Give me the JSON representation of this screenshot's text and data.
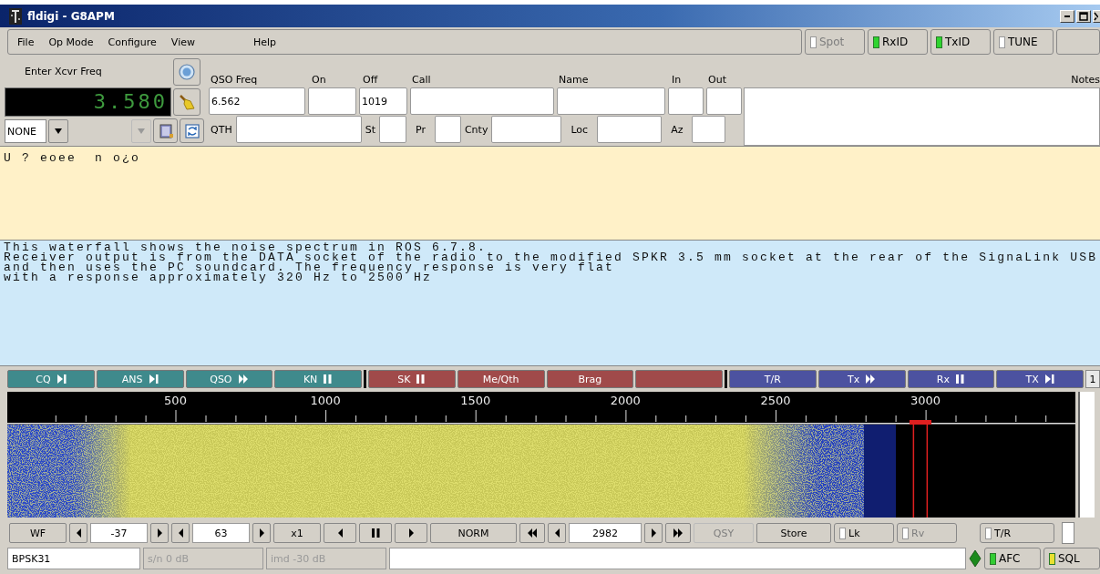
{
  "window": {
    "title": "fldigi - G8APM"
  },
  "menu": [
    {
      "label": "File"
    },
    {
      "label": "Op Mode"
    },
    {
      "label": "Configure"
    },
    {
      "label": "View"
    },
    {
      "label": "Help"
    }
  ],
  "toolbar_toggles": [
    {
      "label": "Spot",
      "on": false,
      "disabled": true
    },
    {
      "label": "RxID",
      "on": true,
      "disabled": false
    },
    {
      "label": "TxID",
      "on": true,
      "disabled": false
    },
    {
      "label": "TUNE",
      "on": false,
      "disabled": false
    }
  ],
  "xcvr": {
    "label": "Enter Xcvr Freq",
    "frequency": "3.580"
  },
  "mode_select": {
    "value": "NONE"
  },
  "log_row_1": [
    {
      "label": "QSO Freq",
      "value": "6.562"
    },
    {
      "label": "On"
    },
    {
      "label": "Off",
      "value": "1019"
    },
    {
      "label": "Call"
    },
    {
      "label": "Name"
    },
    {
      "label": "In"
    },
    {
      "label": "Out"
    }
  ],
  "notes": {
    "label": "Notes"
  },
  "log_row_2": [
    {
      "label": "QTH"
    },
    {
      "label": "St"
    },
    {
      "label": "Pr"
    },
    {
      "label": "Cnty"
    },
    {
      "label": "Loc"
    },
    {
      "label": "Az"
    }
  ],
  "receive_text": "U ? eoee  n o¿o",
  "transmit_text": [
    "This waterfall shows the noise spectrum in ROS 6.7.8.",
    "Receiver output is from the DATA socket of the radio to the modified SPKR 3.5 mm socket at the rear of the SignaLink USB",
    "and then uses the PC soundcard. The frequency response is very flat",
    "with a response approximately 320 Hz to 2500 Hz"
  ],
  "macros": [
    {
      "label": "CQ",
      "kind": "skip",
      "color": "#3f8a8c"
    },
    {
      "label": "ANS",
      "kind": "skip",
      "color": "#3f8a8c"
    },
    {
      "label": "QSO",
      "kind": "forward",
      "color": "#3f8a8c"
    },
    {
      "label": "KN",
      "kind": "pause",
      "color": "#3f8a8c"
    },
    {
      "label": "SK",
      "kind": "pause",
      "color": "#a04a4a"
    },
    {
      "label": "Me/Qth",
      "color": "#a04a4a"
    },
    {
      "label": "Brag",
      "color": "#a04a4a"
    },
    {
      "color": "#a04a4a"
    },
    {
      "label": "T/R",
      "color": "#4c52a0"
    },
    {
      "label": "Tx",
      "kind": "forward",
      "color": "#4c52a0"
    },
    {
      "label": "Rx",
      "kind": "pause",
      "color": "#4c52a0"
    },
    {
      "label": "TX",
      "kind": "skip",
      "color": "#4c52a0"
    }
  ],
  "macro_page": "1",
  "scale": {
    "labels": [
      "500",
      "1000",
      "1500",
      "2000",
      "2500",
      "3000"
    ]
  },
  "controls": [
    {
      "kind": "button",
      "label": "WF"
    },
    {
      "kind": "left"
    },
    {
      "kind": "field",
      "value": "-37"
    },
    {
      "kind": "right"
    },
    {
      "kind": "left"
    },
    {
      "kind": "field",
      "value": "63"
    },
    {
      "kind": "right"
    },
    {
      "kind": "button",
      "label": "x1"
    },
    {
      "kind": "left"
    },
    {
      "kind": "pause"
    },
    {
      "kind": "right"
    },
    {
      "kind": "button",
      "label": "NORM"
    },
    {
      "kind": "rewind"
    },
    {
      "kind": "left"
    },
    {
      "kind": "field",
      "value": "2982"
    },
    {
      "kind": "right"
    },
    {
      "kind": "forward"
    },
    {
      "kind": "button",
      "label": "QSY",
      "disabled": true
    },
    {
      "kind": "button",
      "label": "Store",
      "disabled": false
    },
    {
      "kind": "toggle",
      "label": "Lk",
      "on": false,
      "disabled": false
    },
    {
      "kind": "toggle",
      "label": "Rv",
      "on": false,
      "disabled": true
    },
    {
      "kind": "toggle",
      "label": "T/R",
      "on": false,
      "disabled": false
    }
  ],
  "status_bar": {
    "mode": "BPSK31",
    "snr": "s/n  0 dB",
    "imd": "imd -30 dB",
    "lights": [
      {
        "label": "AFC",
        "on": true,
        "color": "#33cc33"
      },
      {
        "label": "SQL",
        "on": true,
        "color": "#e8e030"
      }
    ]
  }
}
